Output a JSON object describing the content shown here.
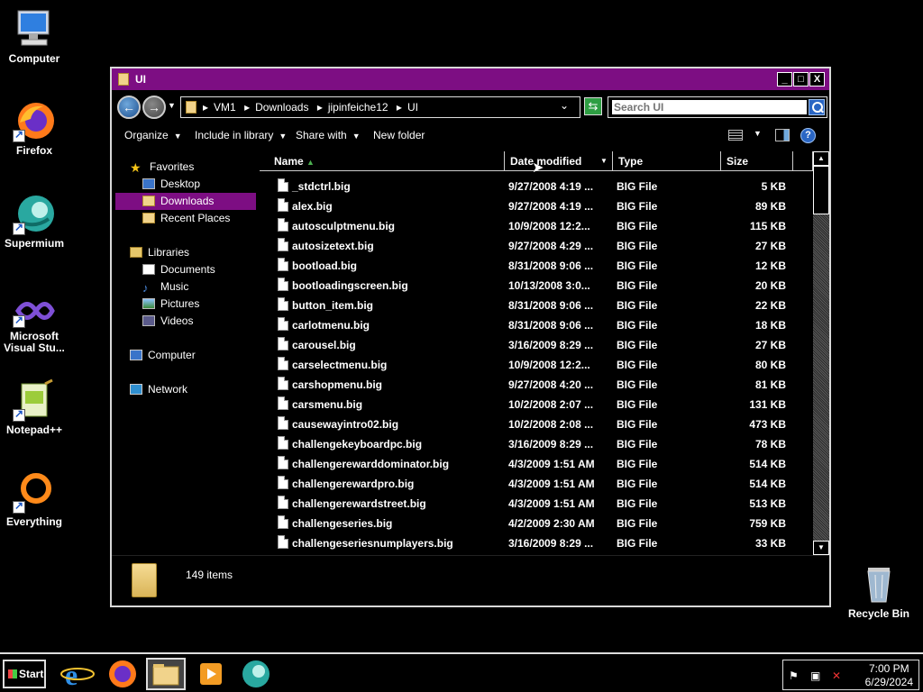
{
  "desktop": {
    "icons": [
      {
        "label": "Computer"
      },
      {
        "label": "Firefox"
      },
      {
        "label": "Supermium"
      },
      {
        "label": "Microsoft Visual Stu..."
      },
      {
        "label": "Notepad++"
      },
      {
        "label": "Everything"
      }
    ],
    "recycle_bin": "Recycle Bin"
  },
  "window": {
    "title": "UI",
    "title_color": "#7d0e83",
    "controls": {
      "minimize": "_",
      "maximize": "□",
      "close": "X"
    },
    "breadcrumb": [
      "VM1",
      "Downloads",
      "jipinfeiche12",
      "UI"
    ],
    "breadcrumb_sep": "▸",
    "search_placeholder": "Search UI",
    "toolbar": {
      "organize": "Organize",
      "include": "Include in library",
      "share": "Share with",
      "new_folder": "New folder"
    },
    "nav": {
      "favorites": "Favorites",
      "desktop": "Desktop",
      "downloads": "Downloads",
      "recent": "Recent Places",
      "libraries": "Libraries",
      "documents": "Documents",
      "music": "Music",
      "pictures": "Pictures",
      "videos": "Videos",
      "computer": "Computer",
      "network": "Network"
    },
    "columns": {
      "name": "Name",
      "date": "Date modified",
      "type": "Type",
      "size": "Size"
    },
    "files": [
      {
        "name": "_stdctrl.big",
        "date": "9/27/2008 4:19 ...",
        "type": "BIG File",
        "size": "5 KB"
      },
      {
        "name": "alex.big",
        "date": "9/27/2008 4:19 ...",
        "type": "BIG File",
        "size": "89 KB"
      },
      {
        "name": "autosculptmenu.big",
        "date": "10/9/2008 12:2...",
        "type": "BIG File",
        "size": "115 KB"
      },
      {
        "name": "autosizetext.big",
        "date": "9/27/2008 4:29 ...",
        "type": "BIG File",
        "size": "27 KB"
      },
      {
        "name": "bootload.big",
        "date": "8/31/2008 9:06 ...",
        "type": "BIG File",
        "size": "12 KB"
      },
      {
        "name": "bootloadingscreen.big",
        "date": "10/13/2008 3:0...",
        "type": "BIG File",
        "size": "20 KB"
      },
      {
        "name": "button_item.big",
        "date": "8/31/2008 9:06 ...",
        "type": "BIG File",
        "size": "22 KB"
      },
      {
        "name": "carlotmenu.big",
        "date": "8/31/2008 9:06 ...",
        "type": "BIG File",
        "size": "18 KB"
      },
      {
        "name": "carousel.big",
        "date": "3/16/2009 8:29 ...",
        "type": "BIG File",
        "size": "27 KB"
      },
      {
        "name": "carselectmenu.big",
        "date": "10/9/2008 12:2...",
        "type": "BIG File",
        "size": "80 KB"
      },
      {
        "name": "carshopmenu.big",
        "date": "9/27/2008 4:20 ...",
        "type": "BIG File",
        "size": "81 KB"
      },
      {
        "name": "carsmenu.big",
        "date": "10/2/2008 2:07 ...",
        "type": "BIG File",
        "size": "131 KB"
      },
      {
        "name": "causewayintro02.big",
        "date": "10/2/2008 2:08 ...",
        "type": "BIG File",
        "size": "473 KB"
      },
      {
        "name": "challengekeyboardpc.big",
        "date": "3/16/2009 8:29 ...",
        "type": "BIG File",
        "size": "78 KB"
      },
      {
        "name": "challengerewarddominator.big",
        "date": "4/3/2009 1:51 AM",
        "type": "BIG File",
        "size": "514 KB"
      },
      {
        "name": "challengerewardpro.big",
        "date": "4/3/2009 1:51 AM",
        "type": "BIG File",
        "size": "514 KB"
      },
      {
        "name": "challengerewardstreet.big",
        "date": "4/3/2009 1:51 AM",
        "type": "BIG File",
        "size": "513 KB"
      },
      {
        "name": "challengeseries.big",
        "date": "4/2/2009 2:30 AM",
        "type": "BIG File",
        "size": "759 KB"
      },
      {
        "name": "challengeseriesnumplayers.big",
        "date": "3/16/2009 8:29 ...",
        "type": "BIG File",
        "size": "33 KB"
      }
    ],
    "item_count": "149 items"
  },
  "taskbar": {
    "start": "Start",
    "time": "7:00 PM",
    "date": "6/29/2024"
  }
}
